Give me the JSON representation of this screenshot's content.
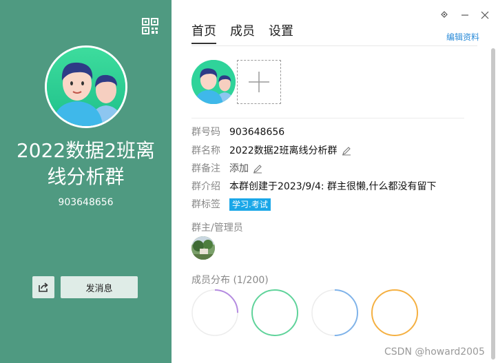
{
  "left": {
    "group_name_line1": "2022数据2班离",
    "group_name_line2": "线分析群",
    "group_number": "903648656",
    "send_message_label": "发消息"
  },
  "tabs": [
    {
      "label": "首页",
      "active": true
    },
    {
      "label": "成员",
      "active": false
    },
    {
      "label": "设置",
      "active": false
    }
  ],
  "edit_profile_label": "编辑资料",
  "info": {
    "number_label": "群号码",
    "number_value": "903648656",
    "name_label": "群名称",
    "name_value": "2022数据2班离线分析群",
    "remark_label": "群备注",
    "remark_value": "添加",
    "intro_label": "群介绍",
    "intro_value": "本群创建于2023/9/4:  群主很懒,什么都没有留下",
    "tag_label": "群标签",
    "tag_value": "学习.考试"
  },
  "admins_label": "群主/管理员",
  "distribution_label": "成员分布 (1/200)",
  "rings": [
    {
      "color": "#b48ae0",
      "fraction": 0.25
    },
    {
      "color": "#5fd39a",
      "fraction": 1.0
    },
    {
      "color": "#7fb3ea",
      "fraction": 0.5
    },
    {
      "color": "#f5b041",
      "fraction": 1.0
    }
  ],
  "watermark": "CSDN @howard2005",
  "colors": {
    "left_panel": "#4f9a81",
    "link": "#2a8bd8",
    "tag_bg": "#1aa7e8"
  }
}
